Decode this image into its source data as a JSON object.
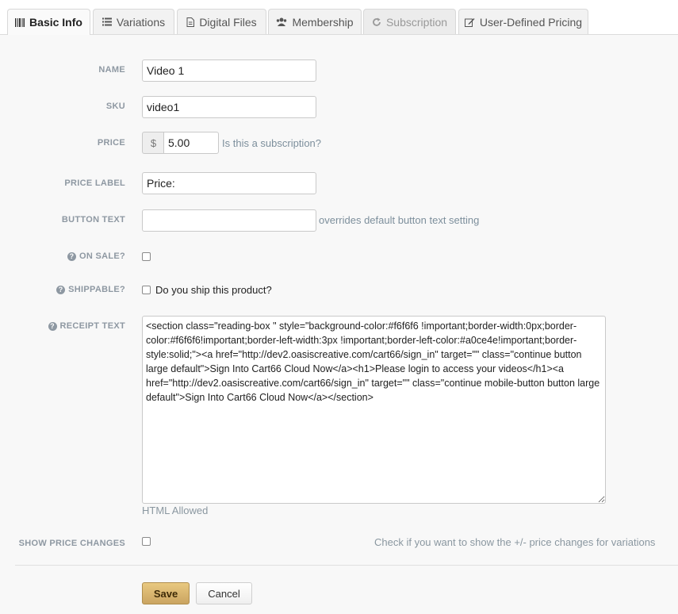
{
  "tabs": [
    {
      "label": "Basic Info",
      "icon": "barcode-icon"
    },
    {
      "label": "Variations",
      "icon": "list-icon"
    },
    {
      "label": "Digital Files",
      "icon": "file-icon"
    },
    {
      "label": "Membership",
      "icon": "users-icon"
    },
    {
      "label": "Subscription",
      "icon": "refresh-icon"
    },
    {
      "label": "User-Defined Pricing",
      "icon": "edit-icon"
    }
  ],
  "form": {
    "name": {
      "label": "NAME",
      "value": "Video 1"
    },
    "sku": {
      "label": "SKU",
      "value": "video1"
    },
    "price": {
      "label": "PRICE",
      "currency": "$",
      "value": "5.00",
      "subscription_link": "Is this a subscription?"
    },
    "price_label": {
      "label": "PRICE LABEL",
      "value": "Price:"
    },
    "button_text": {
      "label": "BUTTON TEXT",
      "value": "",
      "help": "overrides default button text setting"
    },
    "on_sale": {
      "label": "ON SALE?"
    },
    "shippable": {
      "label": "SHIPPABLE?",
      "checkbox_label": "Do you ship this product?"
    },
    "receipt_text": {
      "label": "RECEIPT TEXT",
      "value": "<section class=\"reading-box \" style=\"background-color:#f6f6f6 !important;border-width:0px;border-color:#f6f6f6!important;border-left-width:3px !important;border-left-color:#a0ce4e!important;border-style:solid;\"><a href=\"http://dev2.oasiscreative.com/cart66/sign_in\" target=\"\" class=\"continue button large default\">Sign Into Cart66 Cloud Now</a><h1>Please login to access your videos</h1><a href=\"http://dev2.oasiscreative.com/cart66/sign_in\" target=\"\" class=\"continue mobile-button button large default\">Sign Into Cart66 Cloud Now</a></section>",
      "help": "HTML Allowed"
    },
    "show_price_changes": {
      "label": "SHOW PRICE CHANGES",
      "help": "Check if you want to show the +/- price changes for variations"
    }
  },
  "actions": {
    "save_label": "Save",
    "cancel_label": "Cancel"
  }
}
